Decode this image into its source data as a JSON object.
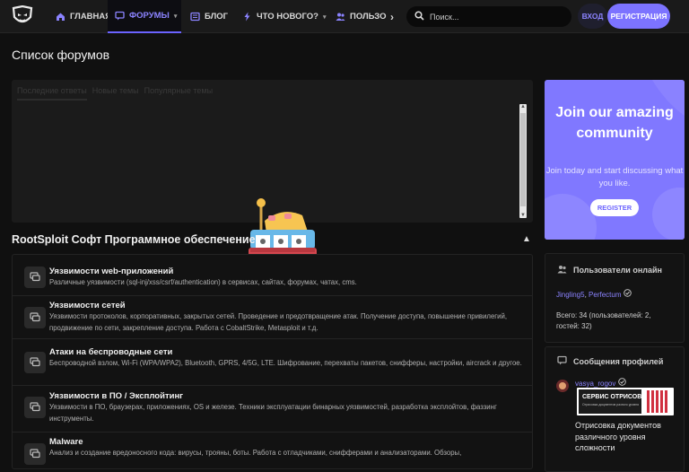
{
  "colors": {
    "accent": "#7c73ff",
    "bg": "#101010",
    "panel": "#1b1b1b"
  },
  "nav": {
    "home": "ГЛАВНАЯ",
    "forums": "ФОРУМЫ",
    "blog": "БЛОГ",
    "whats_new": "ЧТО НОВОГО?",
    "users": "ПОЛЬЗО",
    "more_arrow": "›",
    "search_placeholder": "Поиск...",
    "login": "ВХОД",
    "register": "РЕГИСТРАЦИЯ"
  },
  "page": {
    "title": "Список форумов"
  },
  "activity_tabs": [
    "Последние ответы",
    "Новые темы",
    "Популярные темы"
  ],
  "section": {
    "title": "RootSploit Софт Программное обеспечение"
  },
  "forums": [
    {
      "title": "Уязвимости web-приложений",
      "desc": "Различные уязвимости (sql-inj/xss/csrf/authentication) в сервисах, сайтах, форумах, чатах, cms."
    },
    {
      "title": "Уязвимости сетей",
      "desc": "Уязвимости протоколов, корпоративных, закрытых сетей. Проведение и предотвращение атак. Получение доступа, повышение привилегий, продвижение по сети, закрепление доступа. Работа с CobaltStrike, Metasploit и т.д."
    },
    {
      "title": "Атаки на беспроводные сети",
      "desc": "Беспроводной взлом, Wi-Fi (WPA/WPA2), Bluetooth, GPRS, 4/5G, LTE. Шифрование, перехваты пакетов, снифферы, настройки, aircrack и другое."
    },
    {
      "title": "Уязвимости в ПО / Эксплойтинг",
      "desc": "Уязвимости в ПО, браузерах, приложениях, OS и железе. Техники эксплуатации бинарных уязвимостей, разработка эксплойтов, фаззинг инструменты."
    },
    {
      "title": "Malware",
      "desc": "Анализ и создание вредоносного кода: вирусы, трояны, боты. Работа с отладчиками, снифферами и анализаторами. Обзоры,"
    }
  ],
  "promo": {
    "heading": "Join our amazing community",
    "text": "Join today and start discussing what you like.",
    "button": "REGISTER"
  },
  "online": {
    "title": "Пользователи онлайн",
    "user1": "Jingling5",
    "sep": ", ",
    "user2": "Perfectum",
    "stats": "Всего: 34 (пользователей: 2, гостей: 32)"
  },
  "profile_posts": {
    "title": "Сообщения профилей",
    "author": "vasya_rogov",
    "banner_text": "СЕРВИС ОТРИСОВКИ",
    "banner_sub": "Отрисовка документов разного уровня",
    "post_text": "Отрисовка документов различного уровня сложности"
  }
}
